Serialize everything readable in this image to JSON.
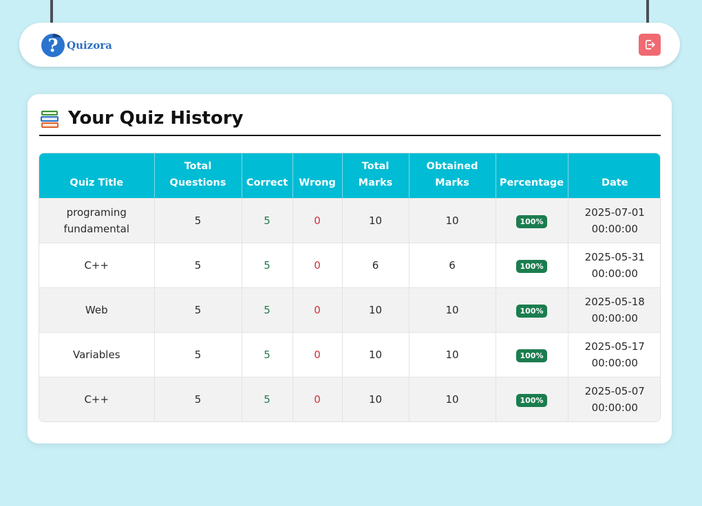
{
  "nav": {
    "brand_name": "Quizora",
    "logout_icon": "logout-icon"
  },
  "colors": {
    "page_bg": "#c8eef6",
    "header_bg": "#00bcd4",
    "badge_bg": "#1b7d4f",
    "correct": "#1f7a4a",
    "wrong": "#d0313f",
    "logout_bg": "#f06a72",
    "brand": "#2a6fc2"
  },
  "history": {
    "title": "Your Quiz History",
    "title_icon": "books-icon",
    "columns": [
      "Quiz Title",
      "Total Questions",
      "Correct",
      "Wrong",
      "Total Marks",
      "Obtained Marks",
      "Percentage",
      "Date"
    ],
    "rows": [
      {
        "title": "programing fundamental",
        "total_questions": "5",
        "correct": "5",
        "wrong": "0",
        "total_marks": "10",
        "obtained_marks": "10",
        "percentage": "100%",
        "date": "2025-07-01 00:00:00"
      },
      {
        "title": "C++",
        "total_questions": "5",
        "correct": "5",
        "wrong": "0",
        "total_marks": "6",
        "obtained_marks": "6",
        "percentage": "100%",
        "date": "2025-05-31 00:00:00"
      },
      {
        "title": "Web",
        "total_questions": "5",
        "correct": "5",
        "wrong": "0",
        "total_marks": "10",
        "obtained_marks": "10",
        "percentage": "100%",
        "date": "2025-05-18 00:00:00"
      },
      {
        "title": "Variables",
        "total_questions": "5",
        "correct": "5",
        "wrong": "0",
        "total_marks": "10",
        "obtained_marks": "10",
        "percentage": "100%",
        "date": "2025-05-17 00:00:00"
      },
      {
        "title": "C++",
        "total_questions": "5",
        "correct": "5",
        "wrong": "0",
        "total_marks": "10",
        "obtained_marks": "10",
        "percentage": "100%",
        "date": "2025-05-07 00:00:00"
      }
    ]
  }
}
